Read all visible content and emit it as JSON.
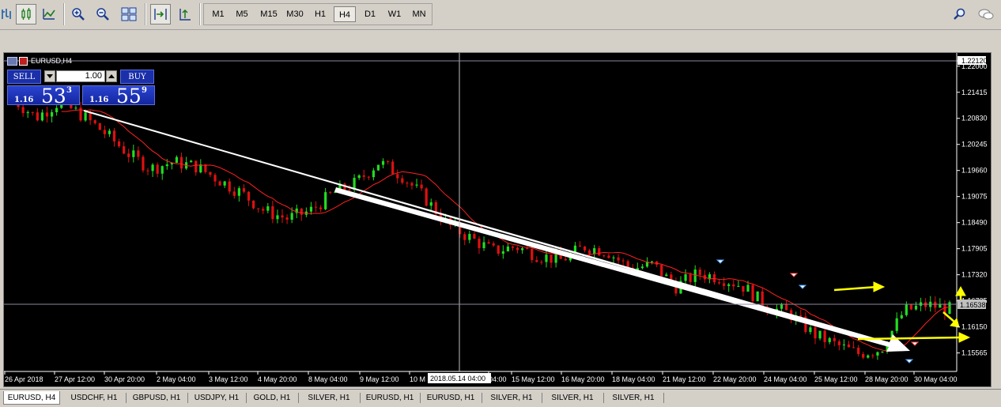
{
  "toolbar": {
    "timeframes": [
      "M1",
      "M5",
      "M15",
      "M30",
      "H1",
      "H4",
      "D1",
      "W1",
      "MN"
    ],
    "active_timeframe": "H4"
  },
  "chart": {
    "title": "EURUSD,H4",
    "price_labels": [
      "1.22120",
      "1.22000",
      "1.21415",
      "1.20830",
      "1.20245",
      "1.19660",
      "1.19075",
      "1.18490",
      "1.17905",
      "1.17320",
      "1.16735",
      "1.16150",
      "1.15565"
    ],
    "current_price": "1.16538",
    "crosshair_time": "2018.05.14 04:00",
    "time_labels": [
      "26 Apr 2018",
      "27 Apr 12:00",
      "30 Apr 20:00",
      "2 May 04:00",
      "3 May 12:00",
      "4 May 20:00",
      "8 May 04:00",
      "9 May 12:00",
      "10 M",
      "04:00",
      "15 May 12:00",
      "16 May 20:00",
      "18 May 04:00",
      "21 May 12:00",
      "22 May 20:00",
      "24 May 04:00",
      "25 May 12:00",
      "28 May 20:00",
      "30 May 04:00"
    ],
    "colors": {
      "bull": "#22dd22",
      "bear": "#dd1111",
      "ma": "#ff2020",
      "trend": "#ffffff",
      "arrows": "#ffff00",
      "background": "#000000"
    }
  },
  "trade_panel": {
    "sell_label": "SELL",
    "buy_label": "BUY",
    "lot_value": "1.00",
    "sell_base": "1.16",
    "sell_big": "53",
    "sell_sup": "3",
    "buy_base": "1.16",
    "buy_big": "55",
    "buy_sup": "9"
  },
  "tabs": [
    "EURUSD, H4",
    "USDCHF, H1",
    "GBPUSD, H1",
    "USDJPY, H1",
    "GOLD, H1",
    "SILVER, H1",
    "EURUSD, H1",
    "EURUSD, H1",
    "SILVER, H1",
    "SILVER, H1",
    "SILVER, H1"
  ],
  "active_tab": "EURUSD, H4",
  "chart_data": {
    "type": "candlestick",
    "symbol": "EURUSD",
    "timeframe": "H4",
    "ylim": [
      1.1515,
      1.2212
    ],
    "x": [
      "26 Apr 2018",
      "27 Apr 12:00",
      "30 Apr 20:00",
      "2 May 04:00",
      "3 May 12:00",
      "4 May 20:00",
      "8 May 04:00",
      "9 May 12:00",
      "10 M",
      "15 May 12:00",
      "16 May 20:00",
      "18 May 04:00",
      "21 May 12:00",
      "22 May 20:00",
      "24 May 04:00",
      "25 May 12:00",
      "28 May 20:00",
      "30 May 04:00"
    ],
    "close_path": [
      1.2125,
      1.2085,
      1.212,
      1.209,
      1.205,
      1.2005,
      1.197,
      1.1985,
      1.1975,
      1.1945,
      1.1915,
      1.1875,
      1.1858,
      1.1875,
      1.1915,
      1.1938,
      1.1985,
      1.1955,
      1.1905,
      1.1845,
      1.1815,
      1.1785,
      1.1795,
      1.1775,
      1.1765,
      1.1795,
      1.1785,
      1.1745,
      1.1755,
      1.1705,
      1.1735,
      1.1725,
      1.1705,
      1.166,
      1.1645,
      1.16,
      1.1575,
      1.1555,
      1.1565,
      1.165,
      1.1665,
      1.1655
    ],
    "last_price": 1.16538
  }
}
